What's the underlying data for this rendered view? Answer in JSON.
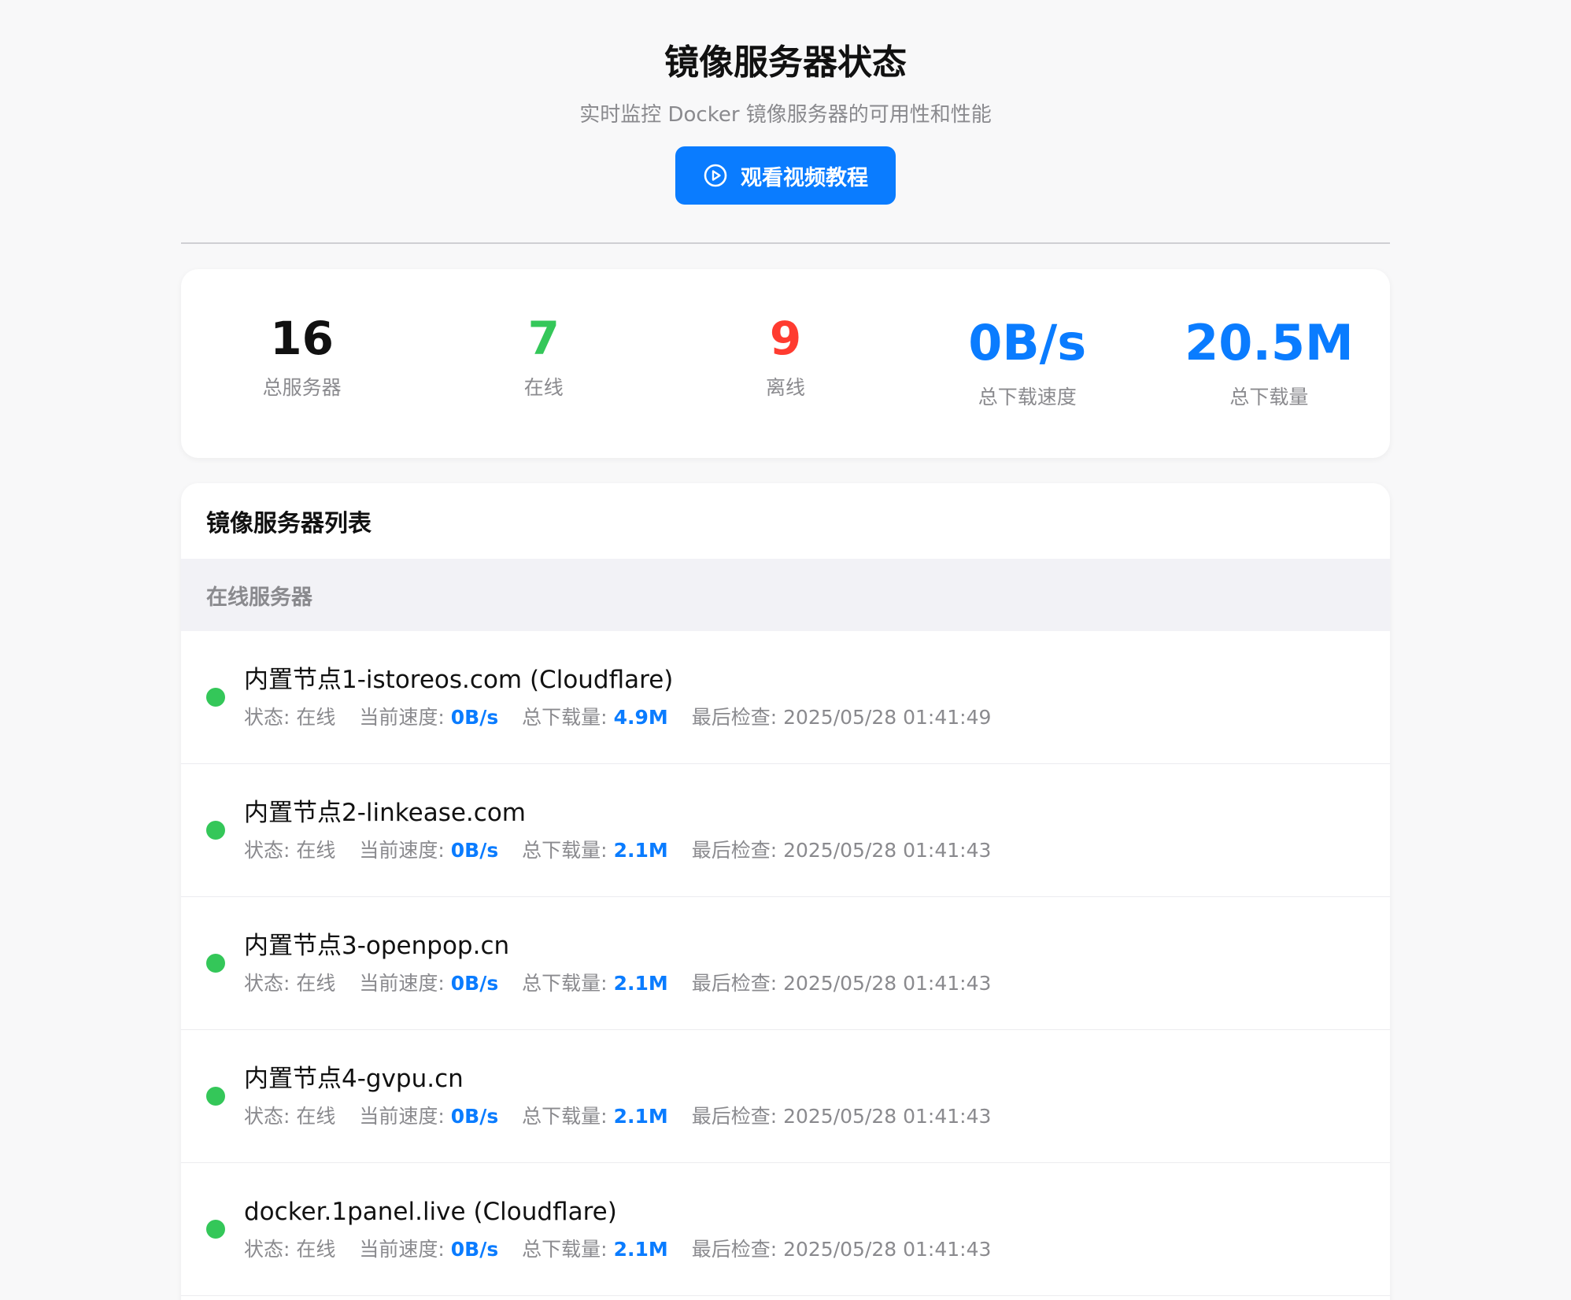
{
  "header": {
    "title": "镜像服务器状态",
    "subtitle": "实时监控 Docker 镜像服务器的可用性和性能",
    "tutorial_button_label": "观看视频教程"
  },
  "colors": {
    "accent": "#0a7cff",
    "online": "#34c759",
    "offline": "#ff3b30",
    "muted": "#8a8a8e"
  },
  "stats": {
    "total_servers": {
      "value": "16",
      "label": "总服务器"
    },
    "online": {
      "value": "7",
      "label": "在线"
    },
    "offline": {
      "value": "9",
      "label": "离线"
    },
    "total_speed": {
      "value": "0B/s",
      "label": "总下载速度"
    },
    "total_downloaded": {
      "value": "20.5M",
      "label": "总下载量"
    }
  },
  "server_list": {
    "title": "镜像服务器列表",
    "online_section_label": "在线服务器",
    "status_label": "状态:",
    "speed_label": "当前速度:",
    "downloaded_label": "总下载量:",
    "last_check_label": "最后检查:",
    "servers": [
      {
        "name": "内置节点1-istoreos.com (Cloudflare)",
        "status": "在线",
        "speed": "0B/s",
        "downloaded": "4.9M",
        "last_check": "2025/05/28 01:41:49"
      },
      {
        "name": "内置节点2-linkease.com",
        "status": "在线",
        "speed": "0B/s",
        "downloaded": "2.1M",
        "last_check": "2025/05/28 01:41:43"
      },
      {
        "name": "内置节点3-openpop.cn",
        "status": "在线",
        "speed": "0B/s",
        "downloaded": "2.1M",
        "last_check": "2025/05/28 01:41:43"
      },
      {
        "name": "内置节点4-gvpu.cn",
        "status": "在线",
        "speed": "0B/s",
        "downloaded": "2.1M",
        "last_check": "2025/05/28 01:41:43"
      },
      {
        "name": "docker.1panel.live (Cloudflare)",
        "status": "在线",
        "speed": "0B/s",
        "downloaded": "2.1M",
        "last_check": "2025/05/28 01:41:43"
      }
    ]
  }
}
